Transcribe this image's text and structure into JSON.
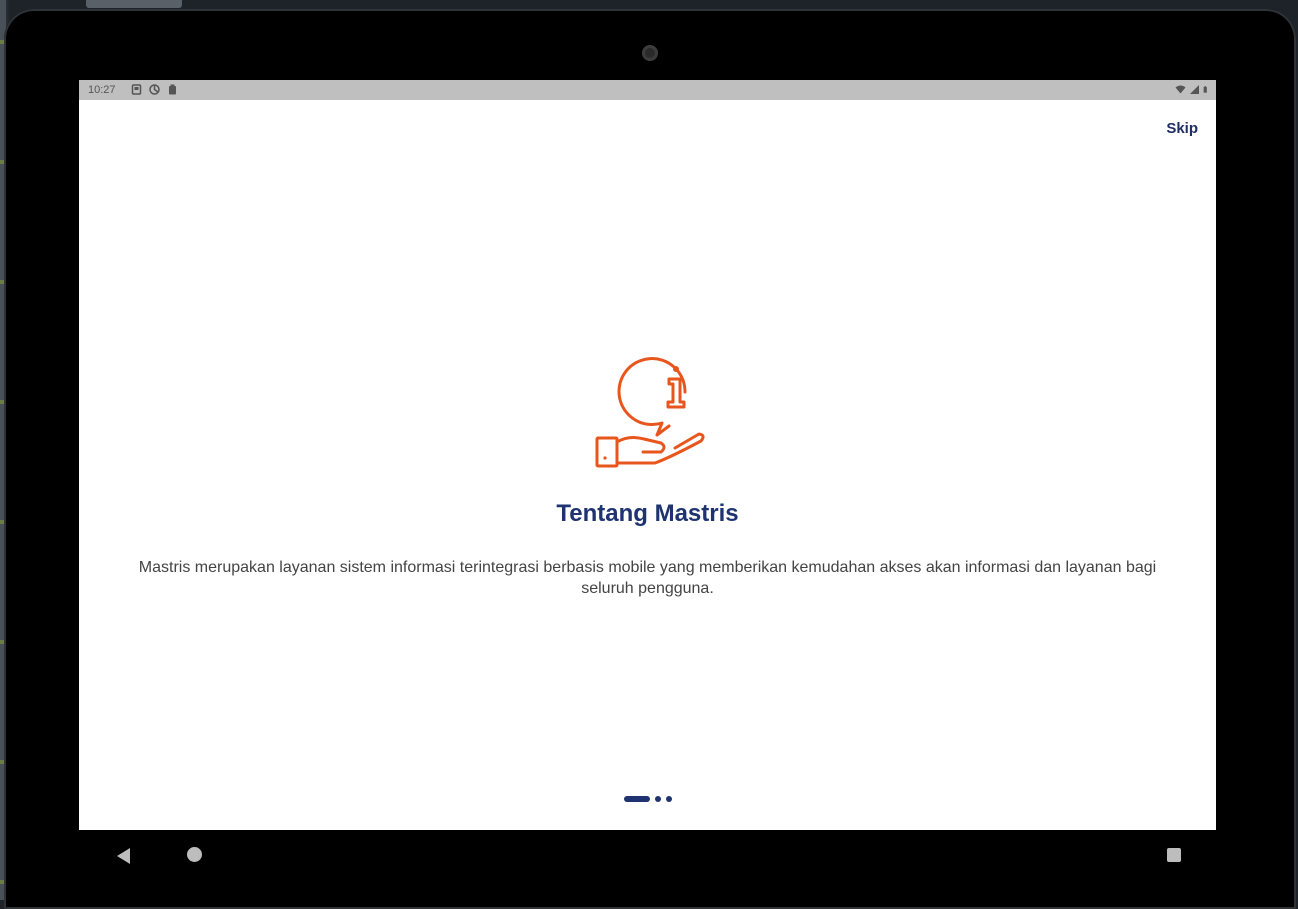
{
  "statusbar": {
    "time": "10:27",
    "left_icons": [
      "sd-card-icon",
      "sync-icon",
      "clipboard-icon"
    ],
    "right_icons": [
      "wifi-icon",
      "signal-icon",
      "battery-icon"
    ]
  },
  "onboarding": {
    "skip_label": "Skip",
    "illustration_icon": "hand-info-icon",
    "title": "Tentang Mastris",
    "description": "Mastris merupakan layanan sistem informasi terintegrasi berbasis mobile yang memberikan kemudahan akses akan informasi dan layanan bagi seluruh pengguna.",
    "pager": {
      "current": 1,
      "total": 3
    }
  },
  "navigation": {
    "buttons": [
      "back-icon",
      "home-icon",
      "recents-icon"
    ]
  },
  "colors": {
    "accent": "#e8561e",
    "primary": "#1e3370",
    "statusbar": "#bfbfbf"
  }
}
